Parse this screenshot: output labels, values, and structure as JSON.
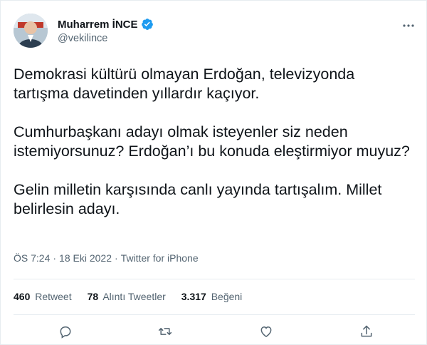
{
  "author": {
    "name": "Muharrem İNCE",
    "handle": "@vekilince",
    "avatar_icon": "profile-photo",
    "verified_color": "#1d9bf0"
  },
  "tweet": {
    "paragraphs": [
      "Demokrasi kültürü olmayan Erdoğan, televizyonda tartışma davetinden yıllardır kaçıyor.",
      "Cumhurbaşkanı adayı olmak isteyenler siz neden istemiyorsunuz? Erdoğan’ı bu konuda eleştirmiyor muyuz?",
      "Gelin milletin karşısında canlı yayında tartışalım. Millet belirlesin adayı."
    ],
    "time": "ÖS 7:24",
    "dot1": "·",
    "date": "18 Eki 2022",
    "dot2": "·",
    "source": "Twitter for iPhone"
  },
  "stats": {
    "retweets_count": "460",
    "retweets_label": "Retweet",
    "quotes_count": "78",
    "quotes_label": "Alıntı Tweetler",
    "likes_count": "3.317",
    "likes_label": "Beğeni"
  },
  "actions": {
    "reply_icon": "comment-icon",
    "retweet_icon": "retweet-icon",
    "like_icon": "heart-icon",
    "share_icon": "share-icon"
  }
}
